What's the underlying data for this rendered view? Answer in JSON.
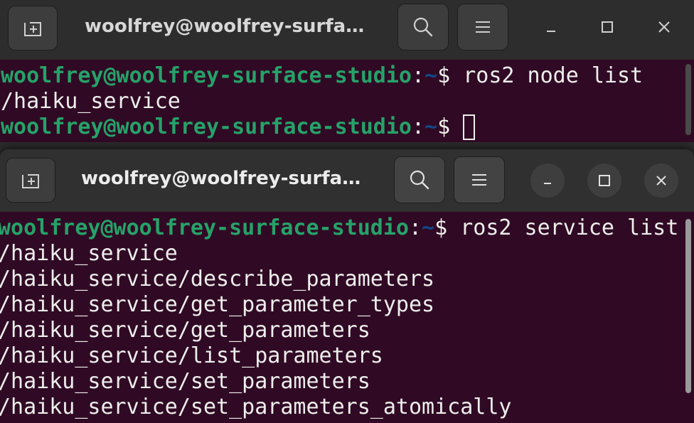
{
  "window1": {
    "title": "woolfrey@woolfrey-surfa…",
    "prompt_user": "woolfrey@woolfrey-surface-studio",
    "prompt_sep": ":",
    "prompt_path": "~",
    "prompt_sign": "$ ",
    "command": "ros2 node list",
    "output": [
      "/haiku_service"
    ]
  },
  "window2": {
    "title": "woolfrey@woolfrey-surfa…",
    "prompt_user": "woolfrey@woolfrey-surface-studio",
    "prompt_sep": ":",
    "prompt_path": "~",
    "prompt_sign": "$ ",
    "command": "ros2 service list",
    "output": [
      "/haiku_service",
      "/haiku_service/describe_parameters",
      "/haiku_service/get_parameter_types",
      "/haiku_service/get_parameters",
      "/haiku_service/list_parameters",
      "/haiku_service/set_parameters",
      "/haiku_service/set_parameters_atomically"
    ]
  },
  "icons": {
    "new_tab": "new-tab-icon",
    "search": "search-icon",
    "menu": "hamburger-menu-icon",
    "minimize": "minimize-icon",
    "maximize": "maximize-icon",
    "close": "close-icon"
  },
  "colors": {
    "terminal_bg": "#300a24",
    "prompt_user": "#26a269",
    "prompt_path": "#12488b",
    "text": "#eeeeec",
    "titlebar_bg": "#2d2d2d"
  }
}
